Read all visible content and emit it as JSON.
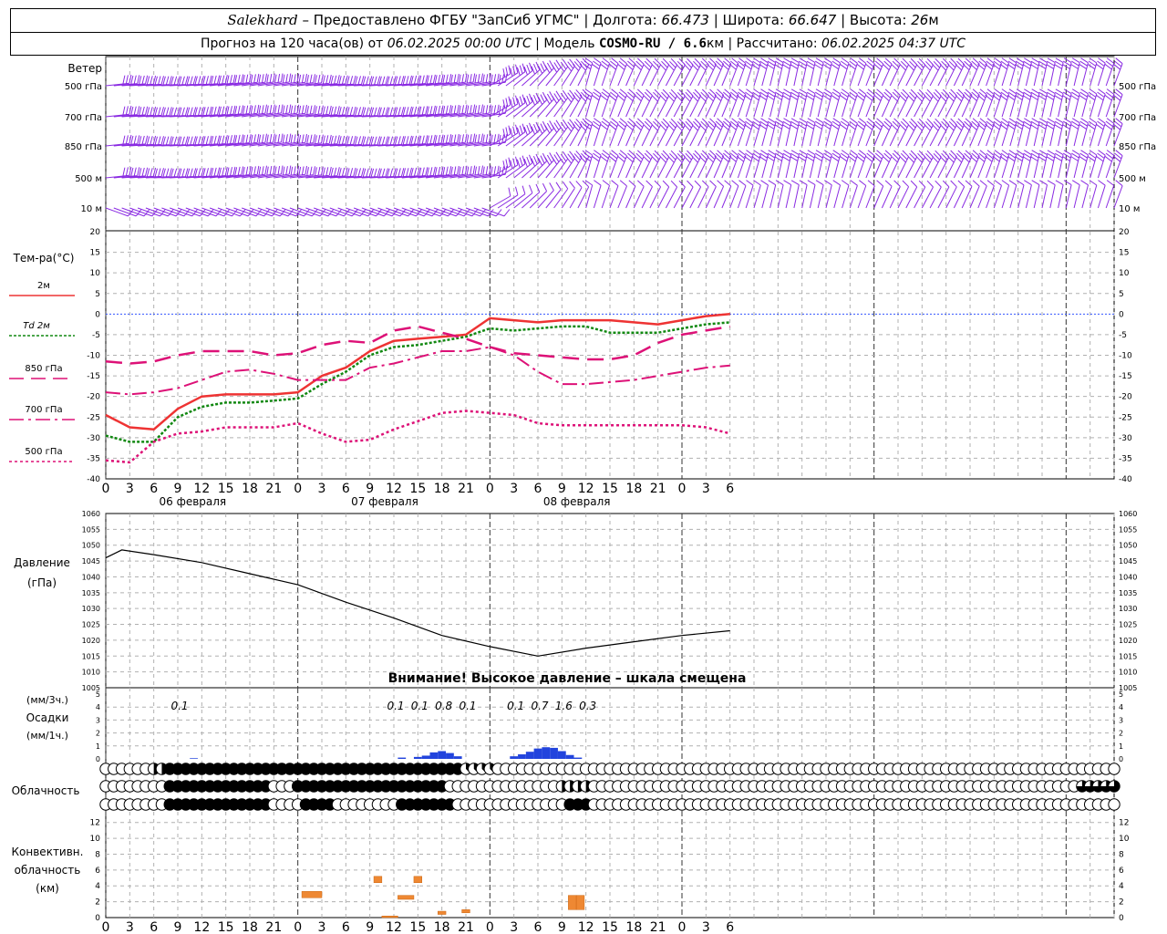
{
  "header": {
    "station": "Salekhard",
    "provider": "– Предоставлено ФГБУ \"ЗапСиб УГМС\"",
    "lon_label": "Долгота:",
    "lon": "66.473",
    "lat_label": "Широта:",
    "lat": "66.647",
    "alt_label": "Высота:",
    "alt_value": "26",
    "alt_unit": "м",
    "forecast_prefix": "Прогноз на 120 часа(ов) от",
    "forecast_start": "06.02.2025 00:00 UTC",
    "model_label": "Модель",
    "model_name": "COSMO-RU / 6.6",
    "model_unit": "км",
    "calc_label": "Рассчитано:",
    "calc_time": "06.02.2025 04:37 UTC"
  },
  "time_axis": {
    "hour_labels": [
      "0",
      "3",
      "6",
      "9",
      "12",
      "15",
      "18",
      "21",
      "0",
      "3",
      "6",
      "9",
      "12",
      "15",
      "18",
      "21",
      "0",
      "3",
      "6",
      "9",
      "12",
      "15",
      "18",
      "21",
      "0",
      "3",
      "6"
    ],
    "day_labels": [
      "06 февраля",
      "07 февраля",
      "08 февраля"
    ]
  },
  "wind_panel": {
    "title": "Ветер",
    "levels": [
      "500 гПа",
      "700 гПа",
      "850 гПа",
      "500 м",
      "10  м"
    ],
    "color": "#8a2be2"
  },
  "temperature_panel": {
    "title": "Тем-ра(°C)",
    "legend": [
      {
        "label": "2м",
        "color": "#ee3333",
        "style": "solid"
      },
      {
        "label": "Td  2м",
        "color": "#118811",
        "style": "dotted"
      },
      {
        "label": "850 гПа",
        "color": "#dd1177",
        "style": "dash"
      },
      {
        "label": "700 гПа",
        "color": "#dd1177",
        "style": "dashdot"
      },
      {
        "label": "500 гПа",
        "color": "#dd1177",
        "style": "dot"
      }
    ],
    "ticks": [
      "20",
      "15",
      "10",
      "5",
      "0",
      "-5",
      "-10",
      "-15",
      "-20",
      "-25",
      "-30",
      "-35",
      "-40"
    ]
  },
  "pressure_panel": {
    "title_line1": "Давление",
    "title_line2": "(гПа)",
    "ticks": [
      "1060",
      "1055",
      "1050",
      "1045",
      "1040",
      "1035",
      "1030",
      "1025",
      "1020",
      "1015",
      "1010",
      "1005"
    ],
    "warning": "Внимание! Высокое давление – шкала смещена"
  },
  "precip_panel": {
    "label_3h": "(мм/3ч.)",
    "label_main": "Осадки",
    "label_1h": "(мм/1ч.)",
    "ticks": [
      "5",
      "4",
      "3",
      "2",
      "1",
      "0"
    ],
    "annotations": [
      {
        "hour": 9,
        "text": "0.1"
      },
      {
        "hour": 36,
        "text": "0.1"
      },
      {
        "hour": 39,
        "text": "0.1"
      },
      {
        "hour": 42,
        "text": "0.8"
      },
      {
        "hour": 45,
        "text": "0.1"
      },
      {
        "hour": 51,
        "text": "0.1"
      },
      {
        "hour": 54,
        "text": "0.7"
      },
      {
        "hour": 57,
        "text": "1.6"
      },
      {
        "hour": 60,
        "text": "0.3"
      }
    ]
  },
  "cloud_panel": {
    "title": "Облачность"
  },
  "convective_panel": {
    "title_line1": "Конвективн.",
    "title_line2": "облачность",
    "title_line3": "(км)",
    "ticks": [
      "12",
      "10",
      "8",
      "6",
      "4",
      "2",
      "0"
    ]
  },
  "chart_data": [
    {
      "type": "barbs",
      "title": "Ветер",
      "levels": [
        "500 гПа",
        "700 гПа",
        "850 гПа",
        "500 м",
        "10  м"
      ],
      "note": "hourly wind barbs, 0–126 h"
    },
    {
      "type": "line",
      "title": "Тем-ра(°C)",
      "x_hours": [
        0,
        3,
        6,
        9,
        12,
        15,
        18,
        21,
        24,
        27,
        30,
        33,
        36,
        39,
        42,
        45,
        48,
        51,
        54,
        57,
        60,
        63,
        66,
        69,
        72,
        75,
        78
      ],
      "ylim": [
        -40,
        20
      ],
      "series": [
        {
          "name": "2м",
          "color": "#ee3333",
          "values": [
            -24.5,
            -27.5,
            -28,
            -23,
            -20,
            -19.5,
            -19.5,
            -19.5,
            -19,
            -15,
            -13,
            -9,
            -6.5,
            -6,
            -5.5,
            -5,
            -1,
            -1.5,
            -2,
            -1.5,
            -1.5,
            -1.5,
            -2,
            -2.5,
            -1.5,
            -0.5,
            0
          ]
        },
        {
          "name": "Td  2м",
          "color": "#118811",
          "values": [
            -29.5,
            -31,
            -31,
            -25,
            -22.5,
            -21.5,
            -21.5,
            -21,
            -20.5,
            -17,
            -14,
            -10,
            -8,
            -7.5,
            -6.5,
            -5.5,
            -3.5,
            -4,
            -3.5,
            -3,
            -3,
            -4.5,
            -4.5,
            -4.5,
            -3.5,
            -2.5,
            -2
          ]
        },
        {
          "name": "850 гПа",
          "color": "#dd1177",
          "values": [
            -11.5,
            -12,
            -11.5,
            -10,
            -9,
            -9,
            -9,
            -10,
            -9.5,
            -7.5,
            -6.5,
            -7,
            -4,
            -3,
            -4.5,
            -6,
            -8,
            -9.5,
            -10,
            -10.5,
            -11,
            -11,
            -10,
            -7,
            -5,
            -4,
            -3
          ]
        },
        {
          "name": "700 гПа",
          "color": "#dd1177",
          "values": [
            -19,
            -19.5,
            -19,
            -18,
            -16,
            -14,
            -13.5,
            -14.5,
            -16,
            -16,
            -16,
            -13,
            -12,
            -10.5,
            -9,
            -9,
            -8,
            -10,
            -14,
            -17,
            -17,
            -16.5,
            -16,
            -15,
            -14,
            -13,
            -12.5
          ]
        },
        {
          "name": "500 гПа",
          "color": "#dd1177",
          "values": [
            -35.5,
            -36,
            -31,
            -29,
            -28.5,
            -27.5,
            -27.5,
            -27.5,
            -26.5,
            -29,
            -31,
            -30.5,
            -28,
            -26,
            -24,
            -23.5,
            -24,
            -24.5,
            -26.5,
            -27,
            -27,
            -27,
            -27,
            -27,
            -27,
            -27.5,
            -29
          ]
        }
      ]
    },
    {
      "type": "line",
      "title": "Давление (гПа)",
      "x_hours": [
        0,
        2,
        6,
        12,
        18,
        24,
        30,
        36,
        42,
        48,
        54,
        60,
        66,
        72,
        78
      ],
      "ylim": [
        1005,
        1060
      ],
      "series": [
        {
          "name": "",
          "values": [
            1046,
            1048.5,
            1047,
            1044.5,
            1041,
            1037.5,
            1032,
            1027,
            1021.5,
            1018,
            1015,
            1017.5,
            1019.5,
            1021.5,
            1023
          ]
        }
      ]
    },
    {
      "type": "bar",
      "title": "Осадки",
      "ylim": [
        0,
        5
      ],
      "hourly_mm": [
        {
          "hour": 11,
          "value": 0.05
        },
        {
          "hour": 37,
          "value": 0.1
        },
        {
          "hour": 39,
          "value": 0.15
        },
        {
          "hour": 40,
          "value": 0.25
        },
        {
          "hour": 41,
          "value": 0.5
        },
        {
          "hour": 42,
          "value": 0.6
        },
        {
          "hour": 43,
          "value": 0.45
        },
        {
          "hour": 44,
          "value": 0.2
        },
        {
          "hour": 51,
          "value": 0.2
        },
        {
          "hour": 52,
          "value": 0.35
        },
        {
          "hour": 53,
          "value": 0.55
        },
        {
          "hour": 54,
          "value": 0.8
        },
        {
          "hour": 55,
          "value": 0.9
        },
        {
          "hour": 56,
          "value": 0.85
        },
        {
          "hour": 57,
          "value": 0.6
        },
        {
          "hour": 58,
          "value": 0.3
        },
        {
          "hour": 59,
          "value": 0.1
        }
      ]
    },
    {
      "type": "symbols",
      "title": "Облачность",
      "note": "three rows of cloud-cover circles (0–8 octas), hourly, 0–126 h"
    },
    {
      "type": "bar",
      "title": "Конвективн. облачность (км)",
      "ylim": [
        0,
        13
      ],
      "bars": [
        {
          "from_hour": 24.5,
          "to_hour": 27,
          "bottom": 2.5,
          "top": 3.3
        },
        {
          "from_hour": 33.5,
          "to_hour": 34.5,
          "bottom": 4.4,
          "top": 5.2
        },
        {
          "from_hour": 34.5,
          "to_hour": 36.5,
          "bottom": 0,
          "top": 0.2
        },
        {
          "from_hour": 36.5,
          "to_hour": 38.5,
          "bottom": 2.3,
          "top": 2.8
        },
        {
          "from_hour": 38.5,
          "to_hour": 39.5,
          "bottom": 4.4,
          "top": 5.2
        },
        {
          "from_hour": 41.5,
          "to_hour": 42.5,
          "bottom": 0.4,
          "top": 0.8
        },
        {
          "from_hour": 44.5,
          "to_hour": 45.5,
          "bottom": 0.6,
          "top": 1.0
        },
        {
          "from_hour": 57.8,
          "to_hour": 58.8,
          "bottom": 1.0,
          "top": 2.8
        },
        {
          "from_hour": 58.8,
          "to_hour": 59.8,
          "bottom": 1.0,
          "top": 2.8
        }
      ]
    }
  ]
}
